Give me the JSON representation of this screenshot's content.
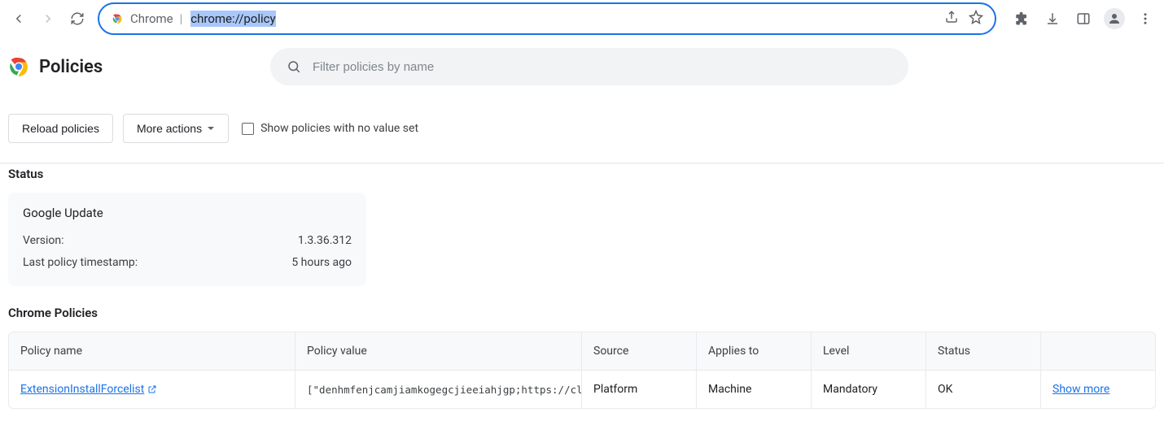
{
  "browser": {
    "site_label": "Chrome",
    "url_text": "chrome://policy"
  },
  "page": {
    "title": "Policies",
    "search_placeholder": "Filter policies by name"
  },
  "controls": {
    "reload": "Reload policies",
    "more_actions": "More actions",
    "show_no_value": "Show policies with no value set",
    "show_no_value_checked": false
  },
  "status": {
    "heading": "Status",
    "card_title": "Google Update",
    "rows": [
      {
        "k": "Version:",
        "v": "1.3.36.312"
      },
      {
        "k": "Last policy timestamp:",
        "v": "5 hours ago"
      }
    ]
  },
  "policies_table": {
    "heading": "Chrome Policies",
    "columns": {
      "name": "Policy name",
      "value": "Policy value",
      "source": "Source",
      "applies": "Applies to",
      "level": "Level",
      "status": "Status"
    },
    "rows": [
      {
        "name": "ExtensionInstallForcelist",
        "value": "[\"denhmfenjcamjiamkogegcjieeiahjgp;https://cl…",
        "source": "Platform",
        "applies": "Machine",
        "level": "Mandatory",
        "status": "OK",
        "more": "Show more"
      }
    ]
  }
}
